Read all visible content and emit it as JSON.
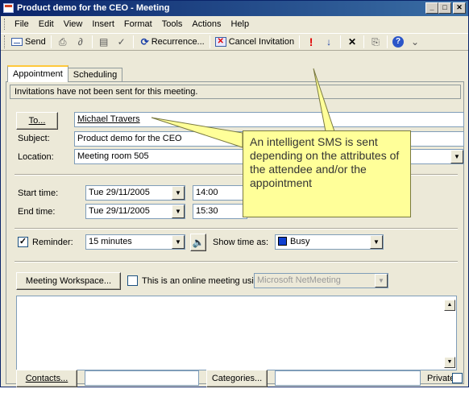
{
  "window": {
    "title": "Product demo for the CEO - Meeting"
  },
  "window_buttons": {
    "minimize": "_",
    "maximize": "□",
    "close": "✕"
  },
  "menu": [
    "File",
    "Edit",
    "View",
    "Insert",
    "Format",
    "Tools",
    "Actions",
    "Help"
  ],
  "toolbar": {
    "send": "Send",
    "recurrence": "Recurrence...",
    "cancel_invitation": "Cancel Invitation"
  },
  "tabs": [
    "Appointment",
    "Scheduling"
  ],
  "info_bar": "Invitations have not been sent for this meeting.",
  "form": {
    "to_button": "To...",
    "to_value": "Michael Travers",
    "subject_label": "Subject:",
    "subject_value": "Product demo for the CEO",
    "location_label": "Location:",
    "location_value": "Meeting room 505",
    "start_label": "Start time:",
    "start_date": "Tue 29/11/2005",
    "start_time": "14:00",
    "end_label": "End time:",
    "end_date": "Tue 29/11/2005",
    "end_time": "15:30",
    "reminder_label": "Reminder:",
    "reminder_checked": true,
    "reminder_value": "15 minutes",
    "show_time_label": "Show time as:",
    "show_time_value": "Busy",
    "busy_color": "#1040d0",
    "workspace_button": "Meeting Workspace...",
    "online_label": "This is an online meeting using:",
    "online_value": "Microsoft NetMeeting"
  },
  "footer": {
    "contacts_button": "Contacts...",
    "categories_button": "Categories...",
    "private_label": "Private"
  },
  "callout": {
    "text": "An intelligent SMS is sent depending on the attributes of  the attendee and/or the appointment",
    "color": "#ffff99"
  },
  "colors": {
    "titlebar": "#0a246a",
    "face": "#ece9d8",
    "tab_highlight": "#ffc83c"
  }
}
